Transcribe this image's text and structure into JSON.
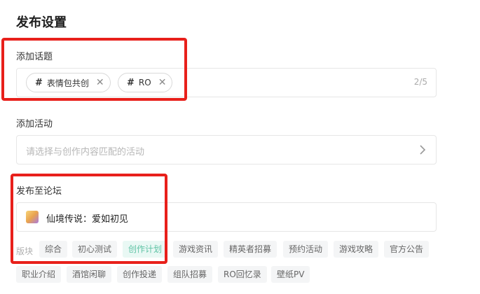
{
  "page_title": "发布设置",
  "topics": {
    "label": "添加话题",
    "tags": [
      {
        "hash": "#",
        "text": "表情包共创"
      },
      {
        "hash": "#",
        "text": "RO"
      }
    ],
    "counter": "2/5"
  },
  "activity": {
    "label": "添加活动",
    "placeholder": "请选择与创作内容匹配的活动"
  },
  "forum": {
    "label": "发布至论坛",
    "selected": "仙境传说：爱如初见"
  },
  "sections": {
    "label": "版块",
    "chips": [
      "综合",
      "初心测试",
      "创作计划",
      "游戏资讯",
      "精英者招募",
      "预约活动",
      "游戏攻略",
      "官方公告",
      "职业介绍",
      "酒馆闲聊",
      "创作投递",
      "组队招募",
      "RO回忆录",
      "壁纸PV"
    ],
    "active": "创作计划"
  },
  "colors": {
    "highlight_box": "#e8201b",
    "active_chip_text": "#5fc3a5",
    "active_chip_bg": "#e9f8f4"
  }
}
